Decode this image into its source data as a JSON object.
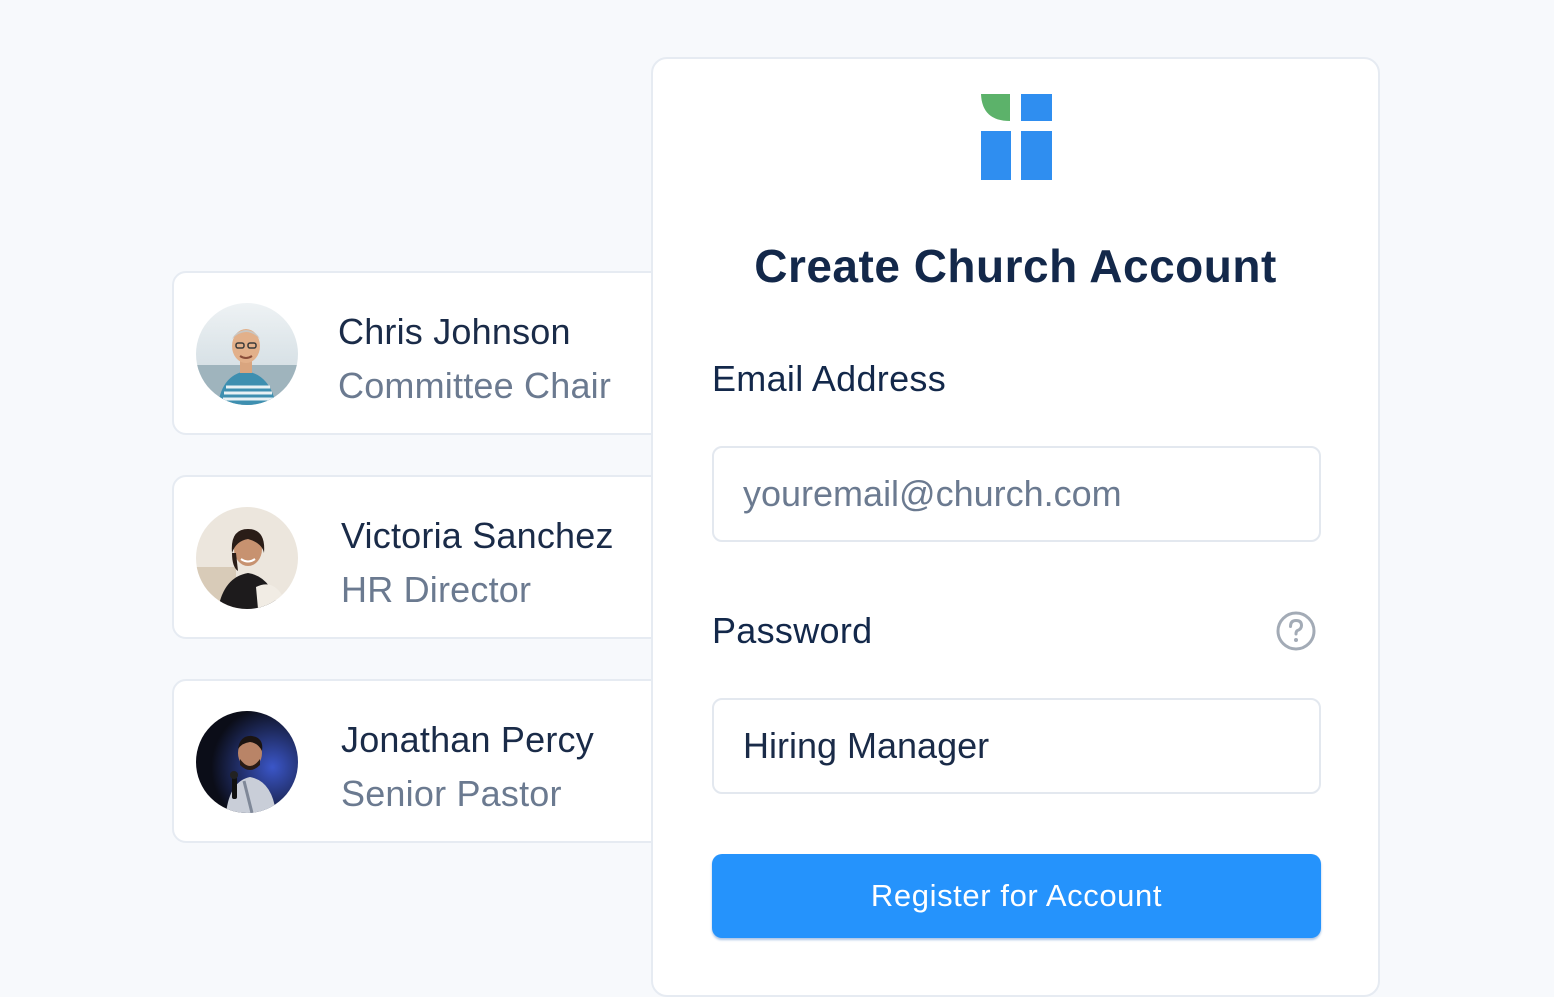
{
  "people": [
    {
      "name": "Chris Johnson",
      "role": "Committee Chair",
      "avatar_icon": "avatar-photo"
    },
    {
      "name": "Victoria Sanchez",
      "role": "HR Director",
      "avatar_icon": "avatar-photo"
    },
    {
      "name": "Jonathan Percy",
      "role": "Senior Pastor",
      "avatar_icon": "avatar-photo"
    }
  ],
  "register": {
    "logo_icon": "church-logo-icon",
    "title": "Create Church Account",
    "email_label": "Email Address",
    "email_placeholder": "youremail@church.com",
    "email_value": "",
    "password_label": "Password",
    "password_help_icon": "help-circle-icon",
    "password_value": "Hiring Manager",
    "submit_label": "Register for Account"
  },
  "colors": {
    "background": "#f7f9fc",
    "primary_button": "#2593fc",
    "logo_blue": "#2f8ef0",
    "logo_green": "#5cb26a",
    "title_text": "#13284a",
    "muted_text": "#6b7a90"
  }
}
